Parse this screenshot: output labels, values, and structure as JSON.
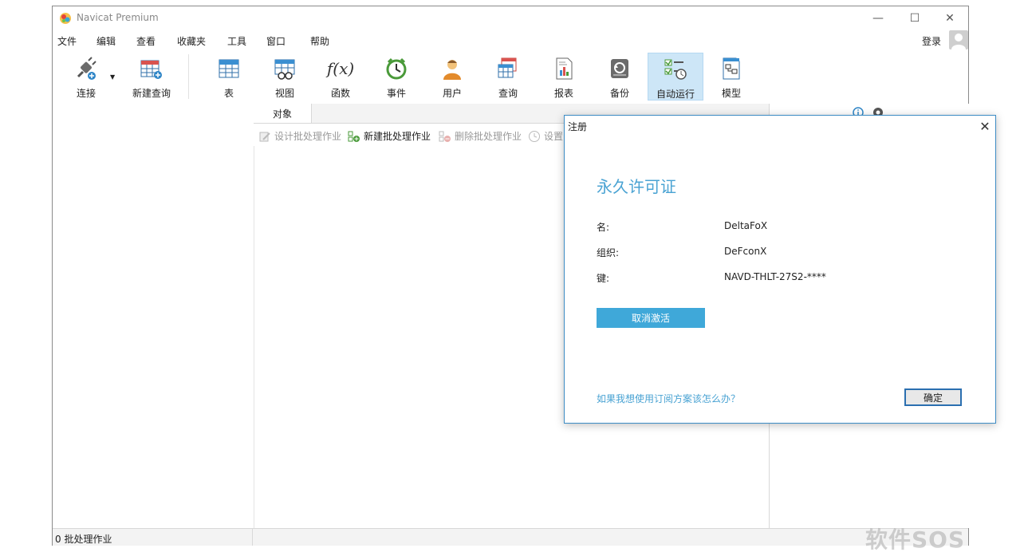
{
  "window": {
    "title": "Navicat Premium",
    "minimize": "—",
    "maximize": "☐",
    "close": "✕"
  },
  "menu": [
    "文件",
    "编辑",
    "查看",
    "收藏夹",
    "工具",
    "窗口",
    "帮助"
  ],
  "login": "登录",
  "toolbar": {
    "items": [
      {
        "label": "连接",
        "icon": "plug-icon"
      },
      {
        "label": "新建查询",
        "icon": "new-query-icon"
      },
      {
        "label": "表",
        "icon": "table-icon"
      },
      {
        "label": "视图",
        "icon": "view-icon"
      },
      {
        "label": "函数",
        "icon": "function-icon"
      },
      {
        "label": "事件",
        "icon": "clock-icon"
      },
      {
        "label": "用户",
        "icon": "user-icon"
      },
      {
        "label": "查询",
        "icon": "query-icon"
      },
      {
        "label": "报表",
        "icon": "report-icon"
      },
      {
        "label": "备份",
        "icon": "backup-icon"
      },
      {
        "label": "自动运行",
        "icon": "automation-icon"
      },
      {
        "label": "模型",
        "icon": "model-icon"
      }
    ],
    "active": "自动运行"
  },
  "tabs": {
    "objects": "对象"
  },
  "object_toolbar": {
    "design": "设计批处理作业",
    "new": "新建批处理作业",
    "delete": "删除批处理作业",
    "settings": "设置"
  },
  "status": {
    "text": "0 批处理作业"
  },
  "dialog": {
    "title": "注册",
    "heading": "永久许可证",
    "fields": [
      {
        "label": "名:",
        "value": "DeltaFoX"
      },
      {
        "label": "组织:",
        "value": "DeFconX"
      },
      {
        "label": "键:",
        "value": "NAVD-THLT-27S2-****"
      }
    ],
    "deactivate": "取消激活",
    "subscription_link": "如果我想使用订阅方案该怎么办？",
    "ok": "确定"
  },
  "watermark": "软件SOS",
  "colors": {
    "accent": "#3fa8d9",
    "active_tool": "#cde6f7",
    "dialog_border": "#3d8cc4"
  }
}
